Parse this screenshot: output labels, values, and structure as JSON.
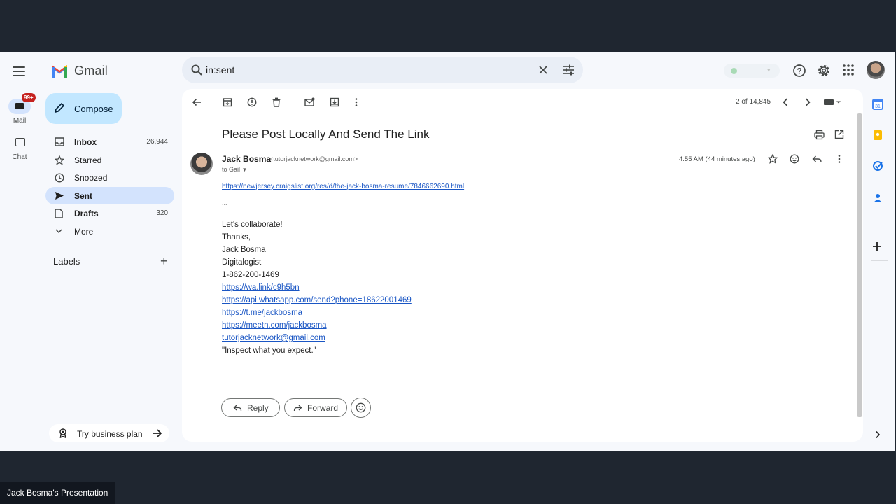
{
  "app": {
    "name": "Gmail",
    "menu_icon": "hamburger-menu-icon"
  },
  "rail": {
    "mail_label": "Mail",
    "mail_badge": "99+",
    "chat_label": "Chat"
  },
  "search": {
    "value": "in:sent"
  },
  "compose": {
    "label": "Compose"
  },
  "nav": [
    {
      "label": "Inbox",
      "count": "26,944",
      "bold": true,
      "icon": "inbox-icon"
    },
    {
      "label": "Starred",
      "count": "",
      "bold": false,
      "icon": "star-icon"
    },
    {
      "label": "Snoozed",
      "count": "",
      "bold": false,
      "icon": "clock-icon"
    },
    {
      "label": "Sent",
      "count": "",
      "bold": true,
      "icon": "send-icon",
      "active": true
    },
    {
      "label": "Drafts",
      "count": "320",
      "bold": true,
      "icon": "draft-icon"
    },
    {
      "label": "More",
      "count": "",
      "bold": false,
      "icon": "chevron-down-icon"
    }
  ],
  "labels": {
    "title": "Labels"
  },
  "promo": {
    "label": "Try business plan"
  },
  "toolbar": {
    "pager": "2 of 14,845"
  },
  "email": {
    "subject": "Please Post Locally And Send The Link",
    "sender_name": "Jack Bosma",
    "sender_email": "<tutorjacknetwork@gmail.com>",
    "to": "to Gail",
    "time": "4:55 AM (44 minutes ago)",
    "link_top": "https://newjersey.craigslist.org/res/d/the-jack-bosma-resume/7846662690.html",
    "trimmed": "...",
    "body": [
      "Let's collaborate!",
      "Thanks,",
      "Jack Bosma",
      "Digitalogist",
      "1-862-200-1469"
    ],
    "links": [
      "https://wa.link/c9h5bn",
      "https://api.whatsapp.com/send?phone=18622001469",
      "https://t.me/jackbosma",
      "https://meetn.com/jackbosma",
      "tutorjacknetwork@gmail.com"
    ],
    "quote": "\"Inspect what you expect.\""
  },
  "actions": {
    "reply": "Reply",
    "forward": "Forward"
  },
  "caption": "Jack Bosma's Presentation",
  "colors": {
    "accent": "#0b57d0",
    "compose_bg": "#c2e7ff",
    "active_nav": "#d3e3fd",
    "badge": "#c5221f"
  }
}
